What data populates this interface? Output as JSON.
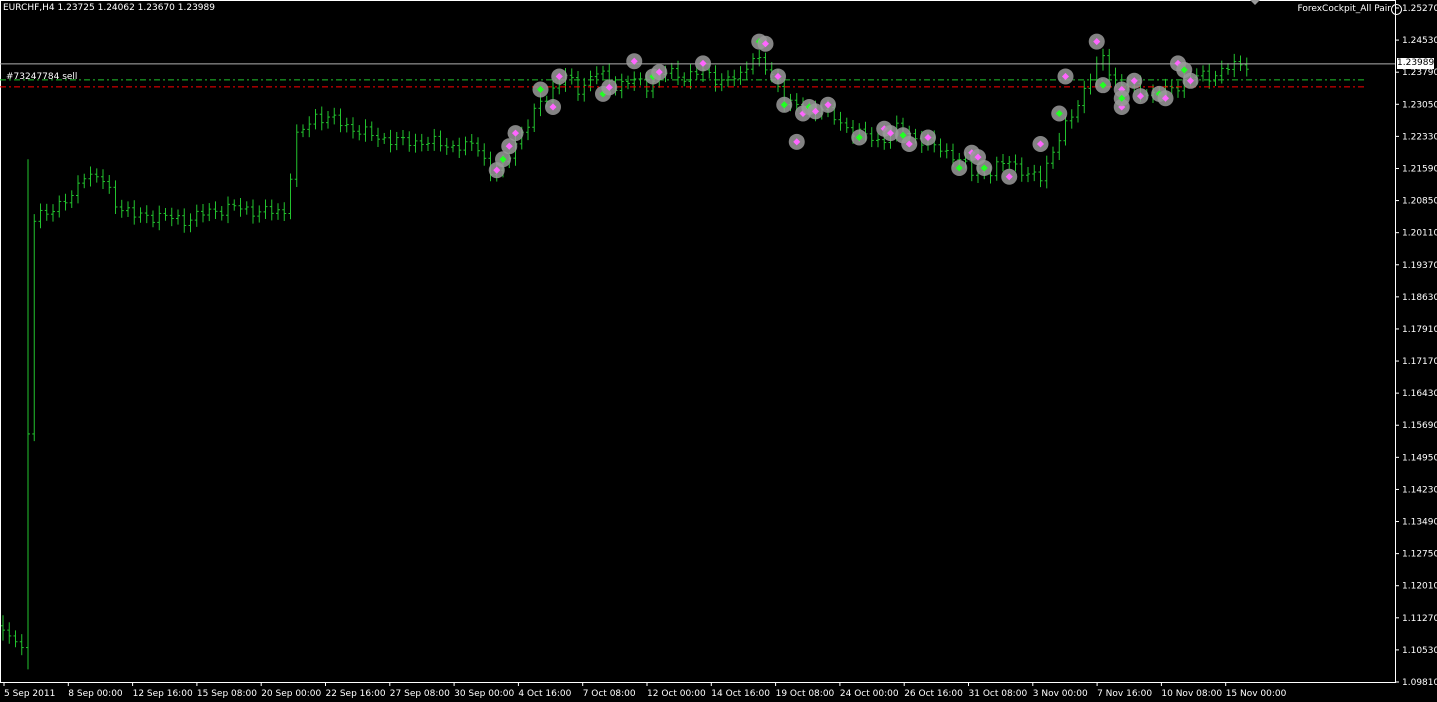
{
  "header": {
    "symbol_info": "EURCHF,H4  1.23725 1.24062 1.23670 1.23989",
    "indicator": "ForexCockpit_All Pair"
  },
  "order": {
    "label": "#73247784 sell",
    "entry_price": 1.2346,
    "tp_price": 1.2362
  },
  "bid": {
    "label": "1.23989",
    "price": 1.23989
  },
  "colors": {
    "background": "#000000",
    "bar": "#22c32e",
    "axis": "#ffffff",
    "order_line": "#ff0000",
    "tp_line": "#22c32e",
    "bid_line": "#b0b0b0",
    "marker_halo": "#9a9a9a",
    "marker_buy": "#22ff22",
    "marker_sell": "#ff66ff"
  },
  "chart_data": {
    "type": "ohlc",
    "title": "",
    "xlabel": "",
    "ylabel": "",
    "ylim": [
      1.0981,
      1.2527
    ],
    "y_ticks": [
      "1.25270",
      "1.24530",
      "1.23790",
      "1.23050",
      "1.22330",
      "1.21590",
      "1.20850",
      "1.20110",
      "1.19370",
      "1.18630",
      "1.17910",
      "1.17170",
      "1.16430",
      "1.15690",
      "1.14950",
      "1.14230",
      "1.13490",
      "1.12750",
      "1.12010",
      "1.11270",
      "1.10530",
      "1.09810"
    ],
    "x_ticks": [
      "5 Sep 2011",
      "8 Sep 00:00",
      "12 Sep 16:00",
      "15 Sep 08:00",
      "20 Sep 00:00",
      "22 Sep 16:00",
      "27 Sep 08:00",
      "30 Sep 00:00",
      "4 Oct 16:00",
      "7 Oct 08:00",
      "12 Oct 00:00",
      "14 Oct 16:00",
      "19 Oct 08:00",
      "24 Oct 00:00",
      "26 Oct 16:00",
      "31 Oct 08:00",
      "3 Nov 00:00",
      "7 Nov 16:00",
      "10 Nov 08:00",
      "15 Nov 00:00"
    ],
    "close_path": [
      [
        0,
        1.11
      ],
      [
        3,
        1.106
      ],
      [
        5,
        1.204
      ],
      [
        8,
        1.207
      ],
      [
        11,
        1.209
      ],
      [
        13,
        1.215
      ],
      [
        16,
        1.213
      ],
      [
        18,
        1.208
      ],
      [
        21,
        1.205
      ],
      [
        25,
        1.205
      ],
      [
        29,
        1.204
      ],
      [
        33,
        1.206
      ],
      [
        37,
        1.207
      ],
      [
        41,
        1.206
      ],
      [
        45,
        1.206
      ],
      [
        47,
        1.223
      ],
      [
        50,
        1.228
      ],
      [
        53,
        1.227
      ],
      [
        56,
        1.225
      ],
      [
        60,
        1.223
      ],
      [
        64,
        1.222
      ],
      [
        68,
        1.222
      ],
      [
        72,
        1.221
      ],
      [
        76,
        1.221
      ],
      [
        78,
        1.215
      ],
      [
        80,
        1.216
      ],
      [
        82,
        1.222
      ],
      [
        84,
        1.226
      ],
      [
        86,
        1.231
      ],
      [
        88,
        1.234
      ],
      [
        90,
        1.237
      ],
      [
        92,
        1.234
      ],
      [
        95,
        1.238
      ],
      [
        98,
        1.235
      ],
      [
        101,
        1.236
      ],
      [
        103,
        1.235
      ],
      [
        106,
        1.238
      ],
      [
        109,
        1.237
      ],
      [
        112,
        1.238
      ],
      [
        115,
        1.236
      ],
      [
        118,
        1.237
      ],
      [
        120,
        1.242
      ],
      [
        123,
        1.237
      ],
      [
        125,
        1.232
      ],
      [
        127,
        1.23
      ],
      [
        129,
        1.229
      ],
      [
        131,
        1.23
      ],
      [
        134,
        1.226
      ],
      [
        137,
        1.224
      ],
      [
        140,
        1.222
      ],
      [
        143,
        1.225
      ],
      [
        146,
        1.223
      ],
      [
        149,
        1.221
      ],
      [
        152,
        1.219
      ],
      [
        155,
        1.215
      ],
      [
        158,
        1.215
      ],
      [
        161,
        1.218
      ],
      [
        164,
        1.214
      ],
      [
        166,
        1.214
      ],
      [
        168,
        1.22
      ],
      [
        171,
        1.228
      ],
      [
        174,
        1.237
      ],
      [
        176,
        1.241
      ],
      [
        178,
        1.236
      ],
      [
        181,
        1.234
      ],
      [
        184,
        1.233
      ],
      [
        187,
        1.234
      ],
      [
        190,
        1.237
      ],
      [
        193,
        1.237
      ],
      [
        196,
        1.239
      ],
      [
        199,
        1.24
      ]
    ],
    "markers": [
      {
        "i": 79,
        "p": 1.2155
      },
      {
        "i": 80,
        "p": 1.218
      },
      {
        "i": 81,
        "p": 1.221
      },
      {
        "i": 82,
        "p": 1.224
      },
      {
        "i": 86,
        "p": 1.234
      },
      {
        "i": 88,
        "p": 1.23
      },
      {
        "i": 89,
        "p": 1.237
      },
      {
        "i": 96,
        "p": 1.233
      },
      {
        "i": 97,
        "p": 1.2345
      },
      {
        "i": 101,
        "p": 1.2405
      },
      {
        "i": 104,
        "p": 1.237
      },
      {
        "i": 105,
        "p": 1.238
      },
      {
        "i": 112,
        "p": 1.24
      },
      {
        "i": 121,
        "p": 1.245
      },
      {
        "i": 122,
        "p": 1.2445
      },
      {
        "i": 124,
        "p": 1.237
      },
      {
        "i": 125,
        "p": 1.2305
      },
      {
        "i": 127,
        "p": 1.222
      },
      {
        "i": 128,
        "p": 1.2285
      },
      {
        "i": 129,
        "p": 1.23
      },
      {
        "i": 130,
        "p": 1.229
      },
      {
        "i": 132,
        "p": 1.2305
      },
      {
        "i": 137,
        "p": 1.223
      },
      {
        "i": 141,
        "p": 1.225
      },
      {
        "i": 142,
        "p": 1.224
      },
      {
        "i": 144,
        "p": 1.2235
      },
      {
        "i": 145,
        "p": 1.2215
      },
      {
        "i": 148,
        "p": 1.223
      },
      {
        "i": 153,
        "p": 1.216
      },
      {
        "i": 155,
        "p": 1.2195
      },
      {
        "i": 156,
        "p": 1.2185
      },
      {
        "i": 157,
        "p": 1.216
      },
      {
        "i": 161,
        "p": 1.214
      },
      {
        "i": 166,
        "p": 1.2215
      },
      {
        "i": 169,
        "p": 1.2285
      },
      {
        "i": 170,
        "p": 1.237
      },
      {
        "i": 175,
        "p": 1.245
      },
      {
        "i": 176,
        "p": 1.235
      },
      {
        "i": 179,
        "p": 1.234
      },
      {
        "i": 179,
        "p": 1.23
      },
      {
        "i": 179,
        "p": 1.232
      },
      {
        "i": 181,
        "p": 1.236
      },
      {
        "i": 182,
        "p": 1.2325
      },
      {
        "i": 185,
        "p": 1.233
      },
      {
        "i": 186,
        "p": 1.232
      },
      {
        "i": 188,
        "p": 1.24
      },
      {
        "i": 189,
        "p": 1.2385
      },
      {
        "i": 190,
        "p": 1.236
      }
    ]
  }
}
